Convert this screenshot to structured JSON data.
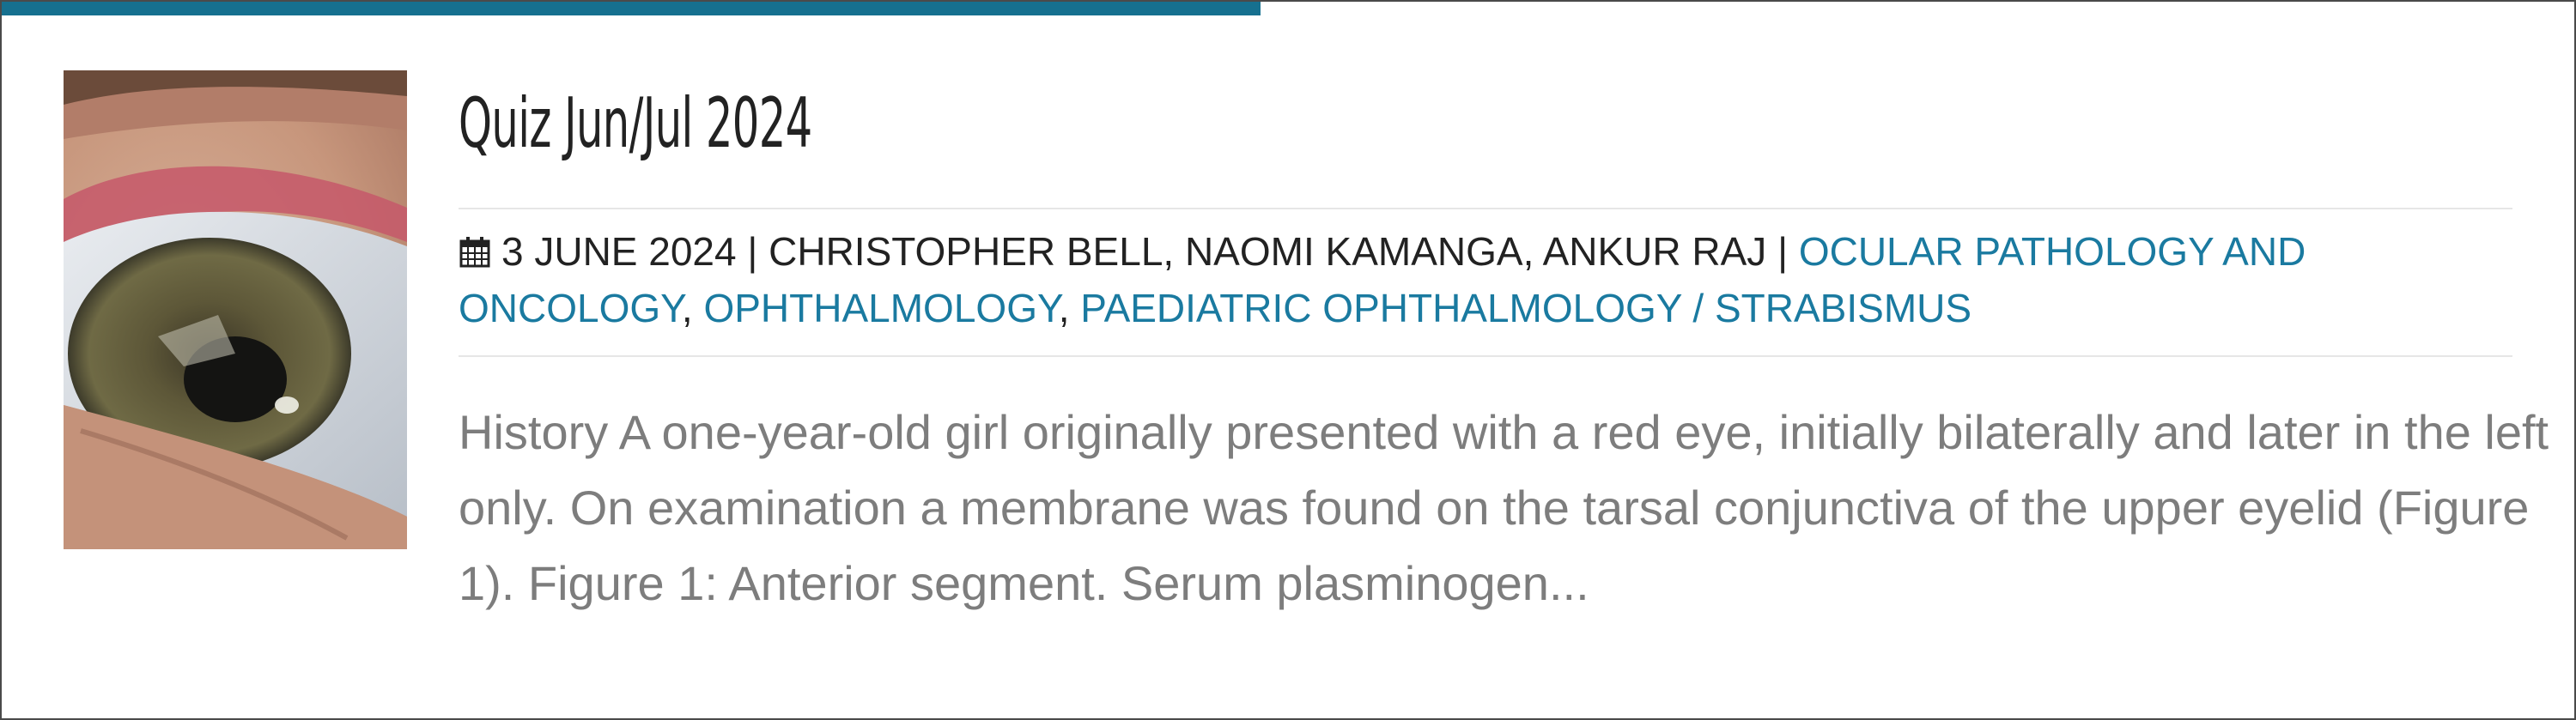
{
  "post": {
    "title": "Quiz Jun/Jul 2024",
    "date": "3 JUNE 2024",
    "separator_1": " | ",
    "authors": "CHRISTOPHER BELL, NAOMI KAMANGA, ANKUR RAJ",
    "separator_2": " | ",
    "categories": [
      "OCULAR PATHOLOGY AND ONCOLOGY",
      "OPHTHALMOLOGY",
      "PAEDIATRIC OPHTHALMOLOGY / STRABISMUS"
    ],
    "category_separator": ", ",
    "excerpt": "History A one-year-old girl originally presented with a red eye, initially bilaterally and later in the left only. On examination a membrane was found on the tarsal conjunctiva of the upper eyelid (Figure 1). Figure 1: Anterior segment. Serum plasminogen...",
    "date_icon": "calendar-icon",
    "thumbnail": "eye-photo"
  },
  "colors": {
    "accent": "#16708f",
    "link": "#1a7aa0",
    "title": "#222222",
    "excerpt": "#7d7d7d",
    "border": "#4a4a4a"
  }
}
